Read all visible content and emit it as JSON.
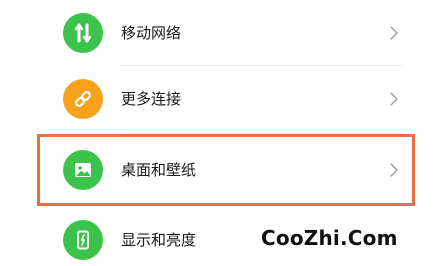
{
  "settings": {
    "items": [
      {
        "label": "移动网络",
        "icon": "mobile-network-icon",
        "icon_color": "#3cc34c"
      },
      {
        "label": "更多连接",
        "icon": "link-icon",
        "icon_color": "#f7a21b"
      },
      {
        "label": "桌面和壁纸",
        "icon": "wallpaper-icon",
        "icon_color": "#3cc34c"
      },
      {
        "label": "显示和亮度",
        "icon": "display-brightness-icon",
        "icon_color": "#3cc34c"
      }
    ],
    "highlight_color": "#e8703d"
  },
  "watermark": {
    "text": "CooZhi.Com"
  }
}
